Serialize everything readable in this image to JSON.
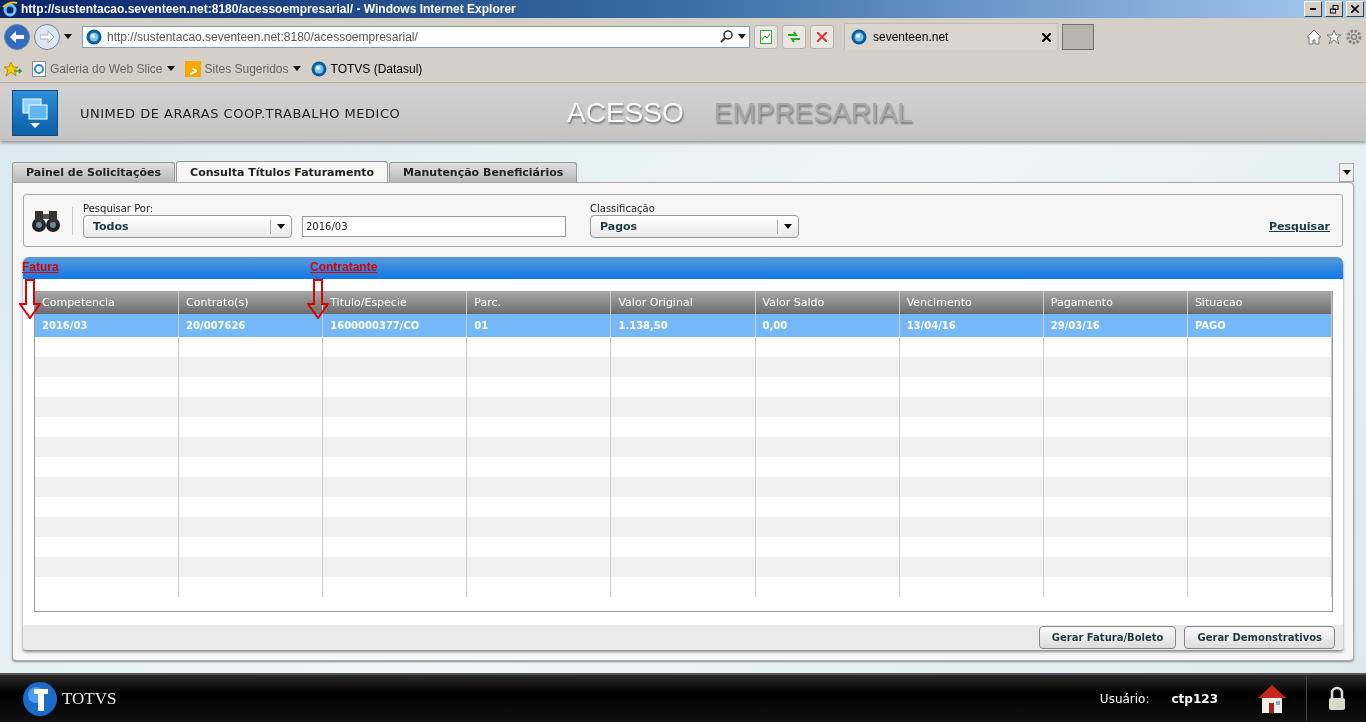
{
  "window": {
    "title": "http://sustentacao.seventeen.net:8180/acessoempresarial/ - Windows Internet Explorer"
  },
  "address_bar": {
    "url": "http://sustentacao.seventeen.net:8180/acessoempresarial/"
  },
  "browser_tabs": [
    {
      "label": "seventeen.net",
      "selected": true
    }
  ],
  "favorites": [
    {
      "label": "Galeria do Web Slice",
      "kind": "ie",
      "dropdown": true
    },
    {
      "label": "Sites Sugeridos",
      "kind": "bing",
      "dropdown": true
    },
    {
      "label": "TOTVS (Datasul)",
      "kind": "globe",
      "dropdown": false
    }
  ],
  "app_header": {
    "company": "UNIMED DE ARARAS COOP.TRABALHO MEDICO",
    "title": [
      "ACESSO",
      "EMPRESARIAL"
    ]
  },
  "tabs": [
    {
      "label": "Painel de Solicitações",
      "selected": false
    },
    {
      "label": "Consulta Títulos Faturamento",
      "selected": true
    },
    {
      "label": "Manutenção Beneficiários",
      "selected": false
    }
  ],
  "search": {
    "search_by_label": "Pesquisar Por:",
    "search_by": "Todos",
    "value": "2016/03",
    "classification_label": "Classificação",
    "classification": "Pagos",
    "search_link": "Pesquisar"
  },
  "annotations": [
    {
      "label": "Fatura"
    },
    {
      "label": "Contratante"
    }
  ],
  "table": {
    "columns": [
      "Competencia",
      "Contrato(s)",
      "Titulo/Especie",
      "Parc.",
      "Valor Original",
      "Valor Saldo",
      "Vencimento",
      "Pagamento",
      "Situacao"
    ],
    "rows": [
      {
        "selected": true,
        "cells": [
          "2016/03",
          "20/007626",
          "1600000377/CO",
          "01",
          "1.138,50",
          "0,00",
          "13/04/16",
          "29/03/16",
          "PAGO"
        ]
      }
    ]
  },
  "buttons": [
    "Gerar Fatura/Boleto",
    "Gerar Demonstrativos"
  ],
  "footer": {
    "brand": "TOTVS",
    "user_label": "Usuário:",
    "user": "ctp123"
  }
}
